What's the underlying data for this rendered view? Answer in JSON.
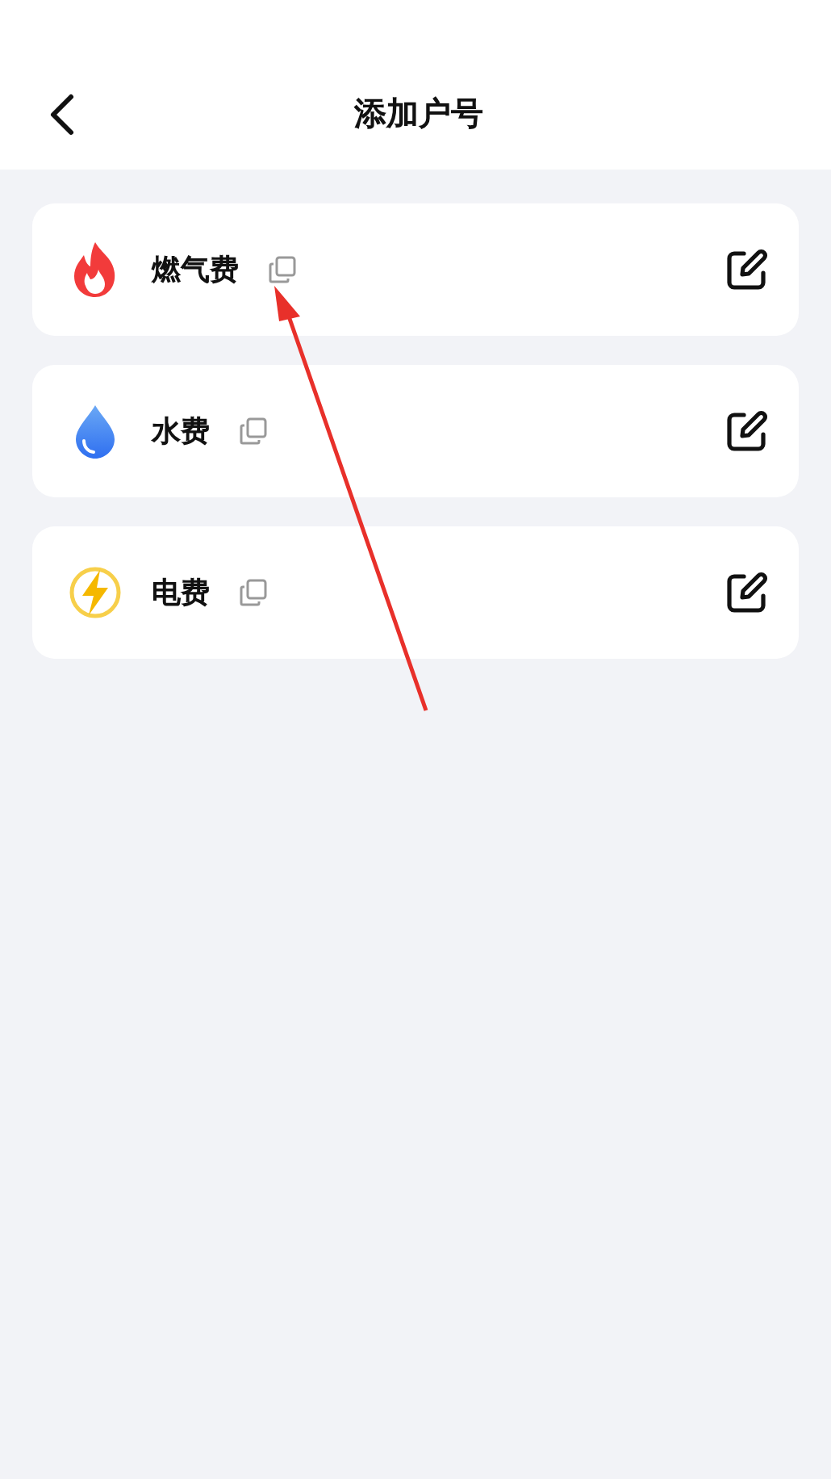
{
  "header": {
    "title": "添加户号"
  },
  "accounts": [
    {
      "kind": "gas",
      "name": "燃气费"
    },
    {
      "kind": "water",
      "name": "水费"
    },
    {
      "kind": "electric",
      "name": "电费"
    }
  ]
}
